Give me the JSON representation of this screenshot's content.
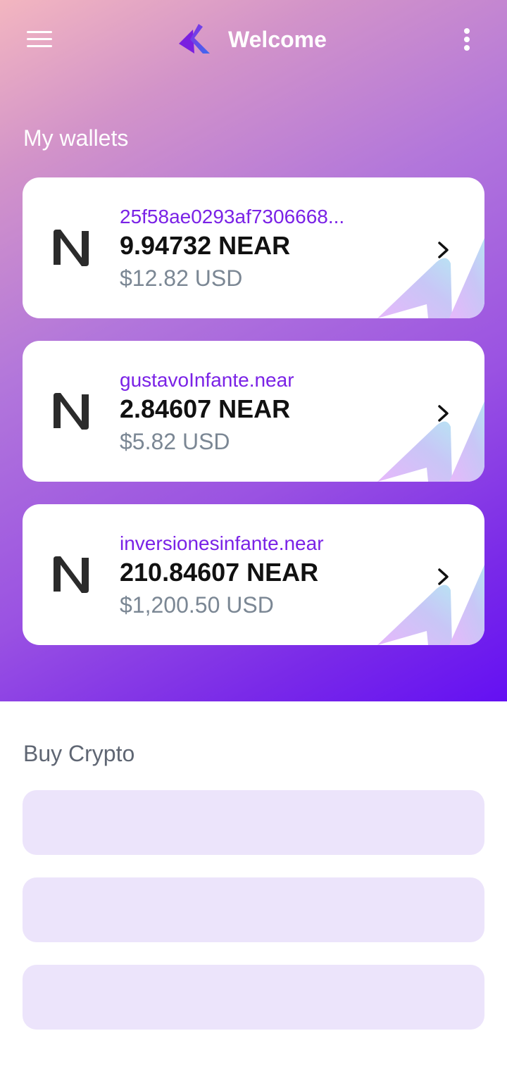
{
  "header": {
    "title": "Welcome",
    "menu_icon": "hamburger-menu-icon",
    "more_icon": "kebab-more-icon",
    "logo": "app-logo"
  },
  "wallets_section": {
    "title": "My wallets",
    "wallets": [
      {
        "account": "25f58ae0293af7306668...",
        "amount": "9.94732 NEAR",
        "usd": "$12.82 USD"
      },
      {
        "account": "gustavoInfante.near",
        "amount": "2.84607 NEAR",
        "usd": "$5.82 USD"
      },
      {
        "account": "inversionesinfante.near",
        "amount": "210.84607 NEAR",
        "usd": "$1,200.50 USD"
      }
    ]
  },
  "buy_section": {
    "title": "Buy Crypto",
    "option_count_note": ""
  },
  "colors": {
    "accent": "#7a22e6",
    "gradient_start": "#f3b6c0",
    "gradient_end": "#6410f3",
    "buy_option_bg": "#ece4fb"
  }
}
